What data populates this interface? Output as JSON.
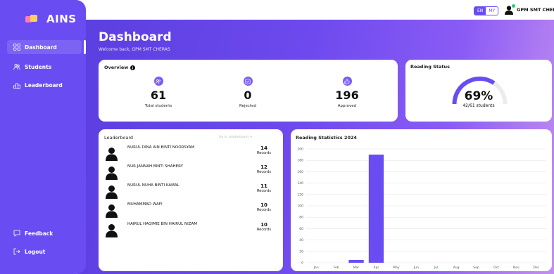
{
  "app": {
    "name": "AINS"
  },
  "sidebar": {
    "items": [
      {
        "label": "Dashboard",
        "icon": "grid-icon",
        "active": true
      },
      {
        "label": "Students",
        "icon": "users-icon"
      },
      {
        "label": "Leaderboard",
        "icon": "podium-icon"
      }
    ],
    "bottom": [
      {
        "label": "Feedback",
        "icon": "message-icon"
      },
      {
        "label": "Logout",
        "icon": "logout-icon"
      }
    ]
  },
  "topbar": {
    "lang_en": "EN",
    "lang_my": "MY",
    "selected_lang": "EN",
    "user_name": "GPM SMT CHERAS"
  },
  "header": {
    "title": "Dashboard",
    "welcome": "Welcome back, GPM SMT CHERAS"
  },
  "overview": {
    "title": "Overview",
    "stats": [
      {
        "value": "61",
        "label": "Total students",
        "icon": "users-icon"
      },
      {
        "value": "0",
        "label": "Rejected",
        "icon": "check-square-icon"
      },
      {
        "value": "196",
        "label": "Approved",
        "icon": "thumbs-up-icon"
      }
    ]
  },
  "reading_status": {
    "title": "Reading Status",
    "percent_text": "69%",
    "percent": 69,
    "detail": "42/61 students"
  },
  "leaderboard": {
    "title": "Leaderboard",
    "link": "Go to Leaderboard →",
    "unit": "Records",
    "rows": [
      {
        "name": "NURUL DINA AIN BINTI NOORSYAM",
        "count": "14"
      },
      {
        "name": "NUR JANNAH BINTI SHAHERY",
        "count": "12"
      },
      {
        "name": "NURUL NUHA BINTI KAMAL",
        "count": "11"
      },
      {
        "name": "MUHAMMAD WAFI",
        "count": "10"
      },
      {
        "name": "HAIRUL HAQIMIE BIN HAIRUL NIZAM",
        "count": "10"
      }
    ]
  },
  "colors": {
    "accent": "#6a4cf3",
    "bar": "#6a4cf3"
  },
  "chart_data": {
    "type": "bar",
    "title": "Reading Statistics 2024",
    "categories": [
      "Jan",
      "Feb",
      "Mar",
      "Apr",
      "May",
      "Jun",
      "Jul",
      "Aug",
      "Sep",
      "Oct",
      "Nov",
      "Dec"
    ],
    "values": [
      0,
      0,
      5,
      190,
      0,
      0,
      0,
      0,
      0,
      0,
      0,
      0
    ],
    "ylim": [
      0,
      200
    ],
    "yticks": [
      0,
      20,
      40,
      60,
      80,
      100,
      120,
      140,
      160,
      180,
      200
    ],
    "grid": true
  }
}
